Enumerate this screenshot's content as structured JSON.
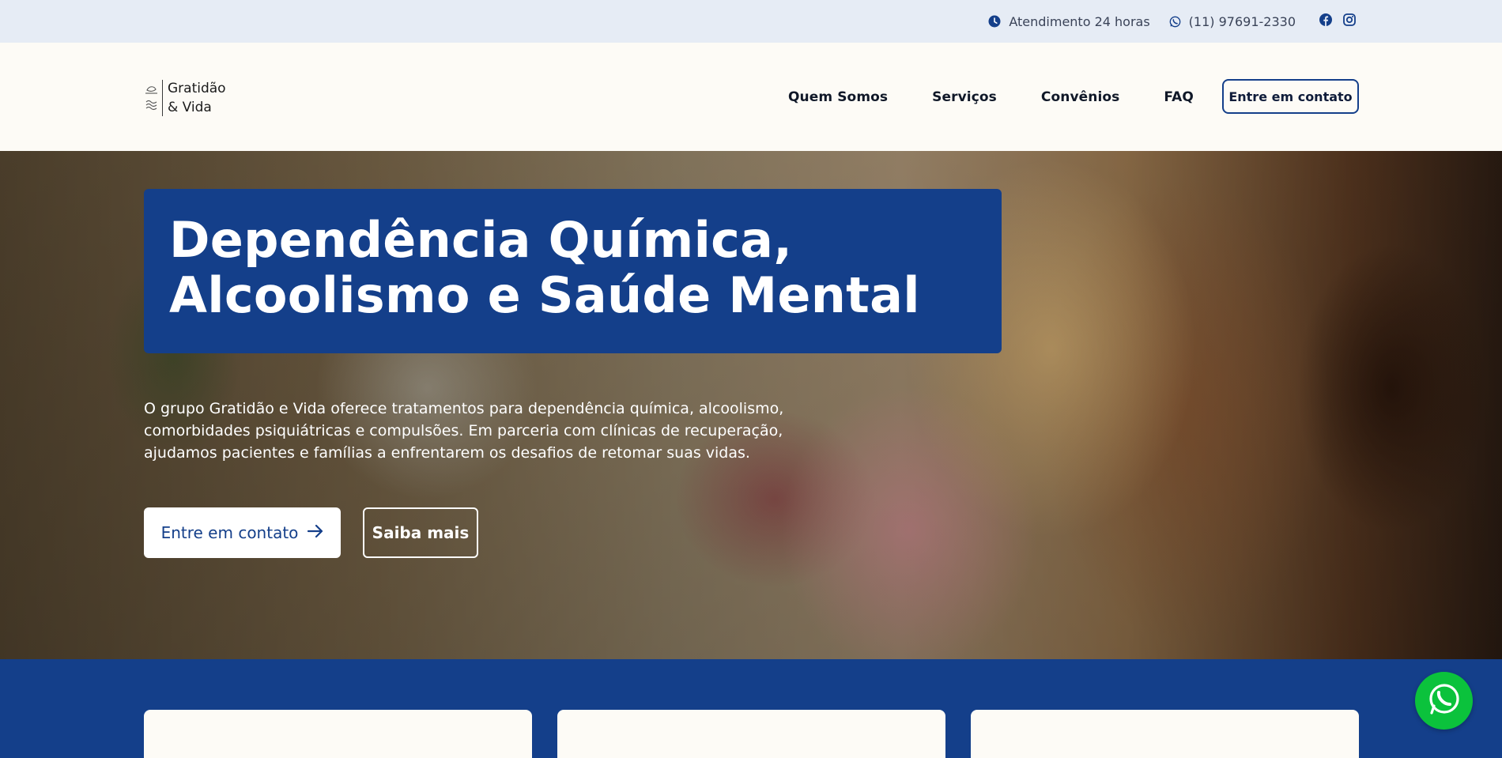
{
  "topbar": {
    "hours_text": "Atendimento 24 horas",
    "phone_text": "(11) 97691-2330",
    "icons": [
      "clock-icon",
      "whatsapp-icon",
      "facebook-icon",
      "instagram-icon"
    ]
  },
  "header": {
    "logo_line1": "Gratidão",
    "logo_line2": "& Vida",
    "nav": [
      "Quem Somos",
      "Serviços",
      "Convênios",
      "FAQ"
    ],
    "cta_label": "Entre em contato"
  },
  "hero": {
    "title_line1": "Dependência Química,",
    "title_line2": "Alcoolismo e Saúde Mental",
    "description": "O grupo Gratidão e Vida oferece tratamentos para dependência química, alcoolismo, comorbidades psiquiátricas e compulsões. Em parceria com clínicas de recuperação, ajudamos pacientes e famílias a enfrentarem os desafios de retomar suas vidas.",
    "primary_button": "Entre em contato",
    "secondary_button": "Saiba mais"
  },
  "colors": {
    "brand_blue": "#143f8a",
    "topbar_bg": "#e6ecf5",
    "page_bg": "#fdfbf6",
    "whatsapp_green": "#0bc23c"
  }
}
